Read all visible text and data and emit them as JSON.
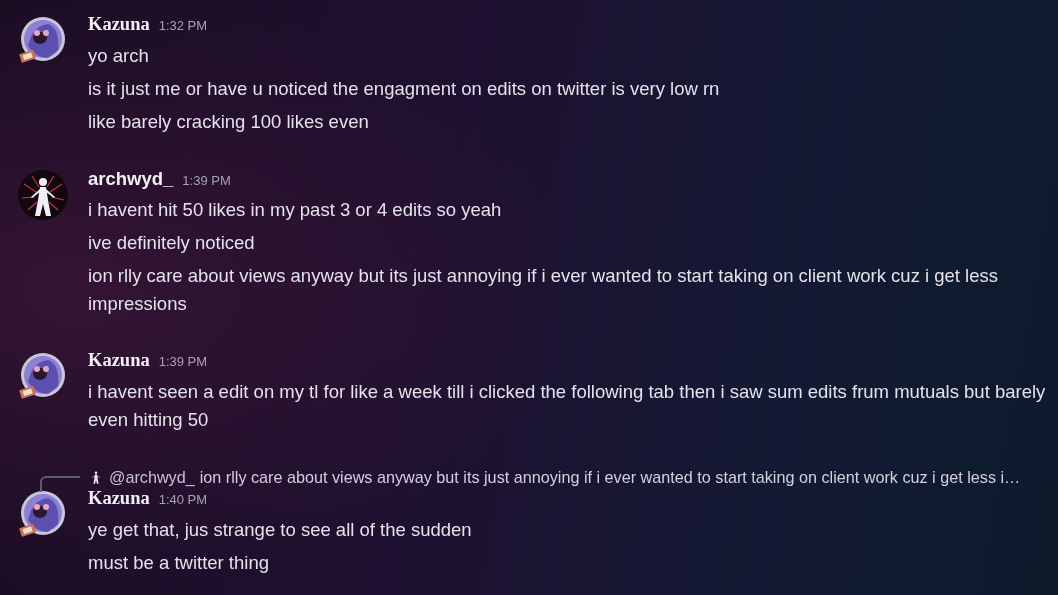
{
  "messages": [
    {
      "author": "Kazuna",
      "kind": "ticket",
      "time": "1:32 PM",
      "lines": [
        "yo arch",
        "is it just me or have u noticed the engagment on edits on twitter is very low rn",
        "like barely cracking 100 likes even"
      ]
    },
    {
      "author": "archwyd_",
      "kind": "figure",
      "time": "1:39 PM",
      "lines": [
        "i havent hit 50 likes in my past 3 or 4 edits so yeah",
        "ive definitely noticed",
        "ion rlly care about views anyway but its just annoying if i ever wanted to start taking on client work cuz i get less impressions"
      ]
    },
    {
      "author": "Kazuna",
      "kind": "ticket",
      "time": "1:39 PM",
      "lines": [
        "i havent seen a edit on my tl for like a week till i clicked the following tab then i saw sum edits frum mutuals but barely even hitting 50"
      ]
    },
    {
      "author": "Kazuna",
      "kind": "ticket",
      "time": "1:40 PM",
      "reply": {
        "mention": "@archwyd_",
        "kind": "figure",
        "text": "ion rlly care about views anyway but its just annoying if i ever wanted to start taking on client work cuz i get less i…"
      },
      "lines": [
        "ye get that, jus strange to see all of the sudden",
        "must be a twitter thing"
      ]
    }
  ]
}
